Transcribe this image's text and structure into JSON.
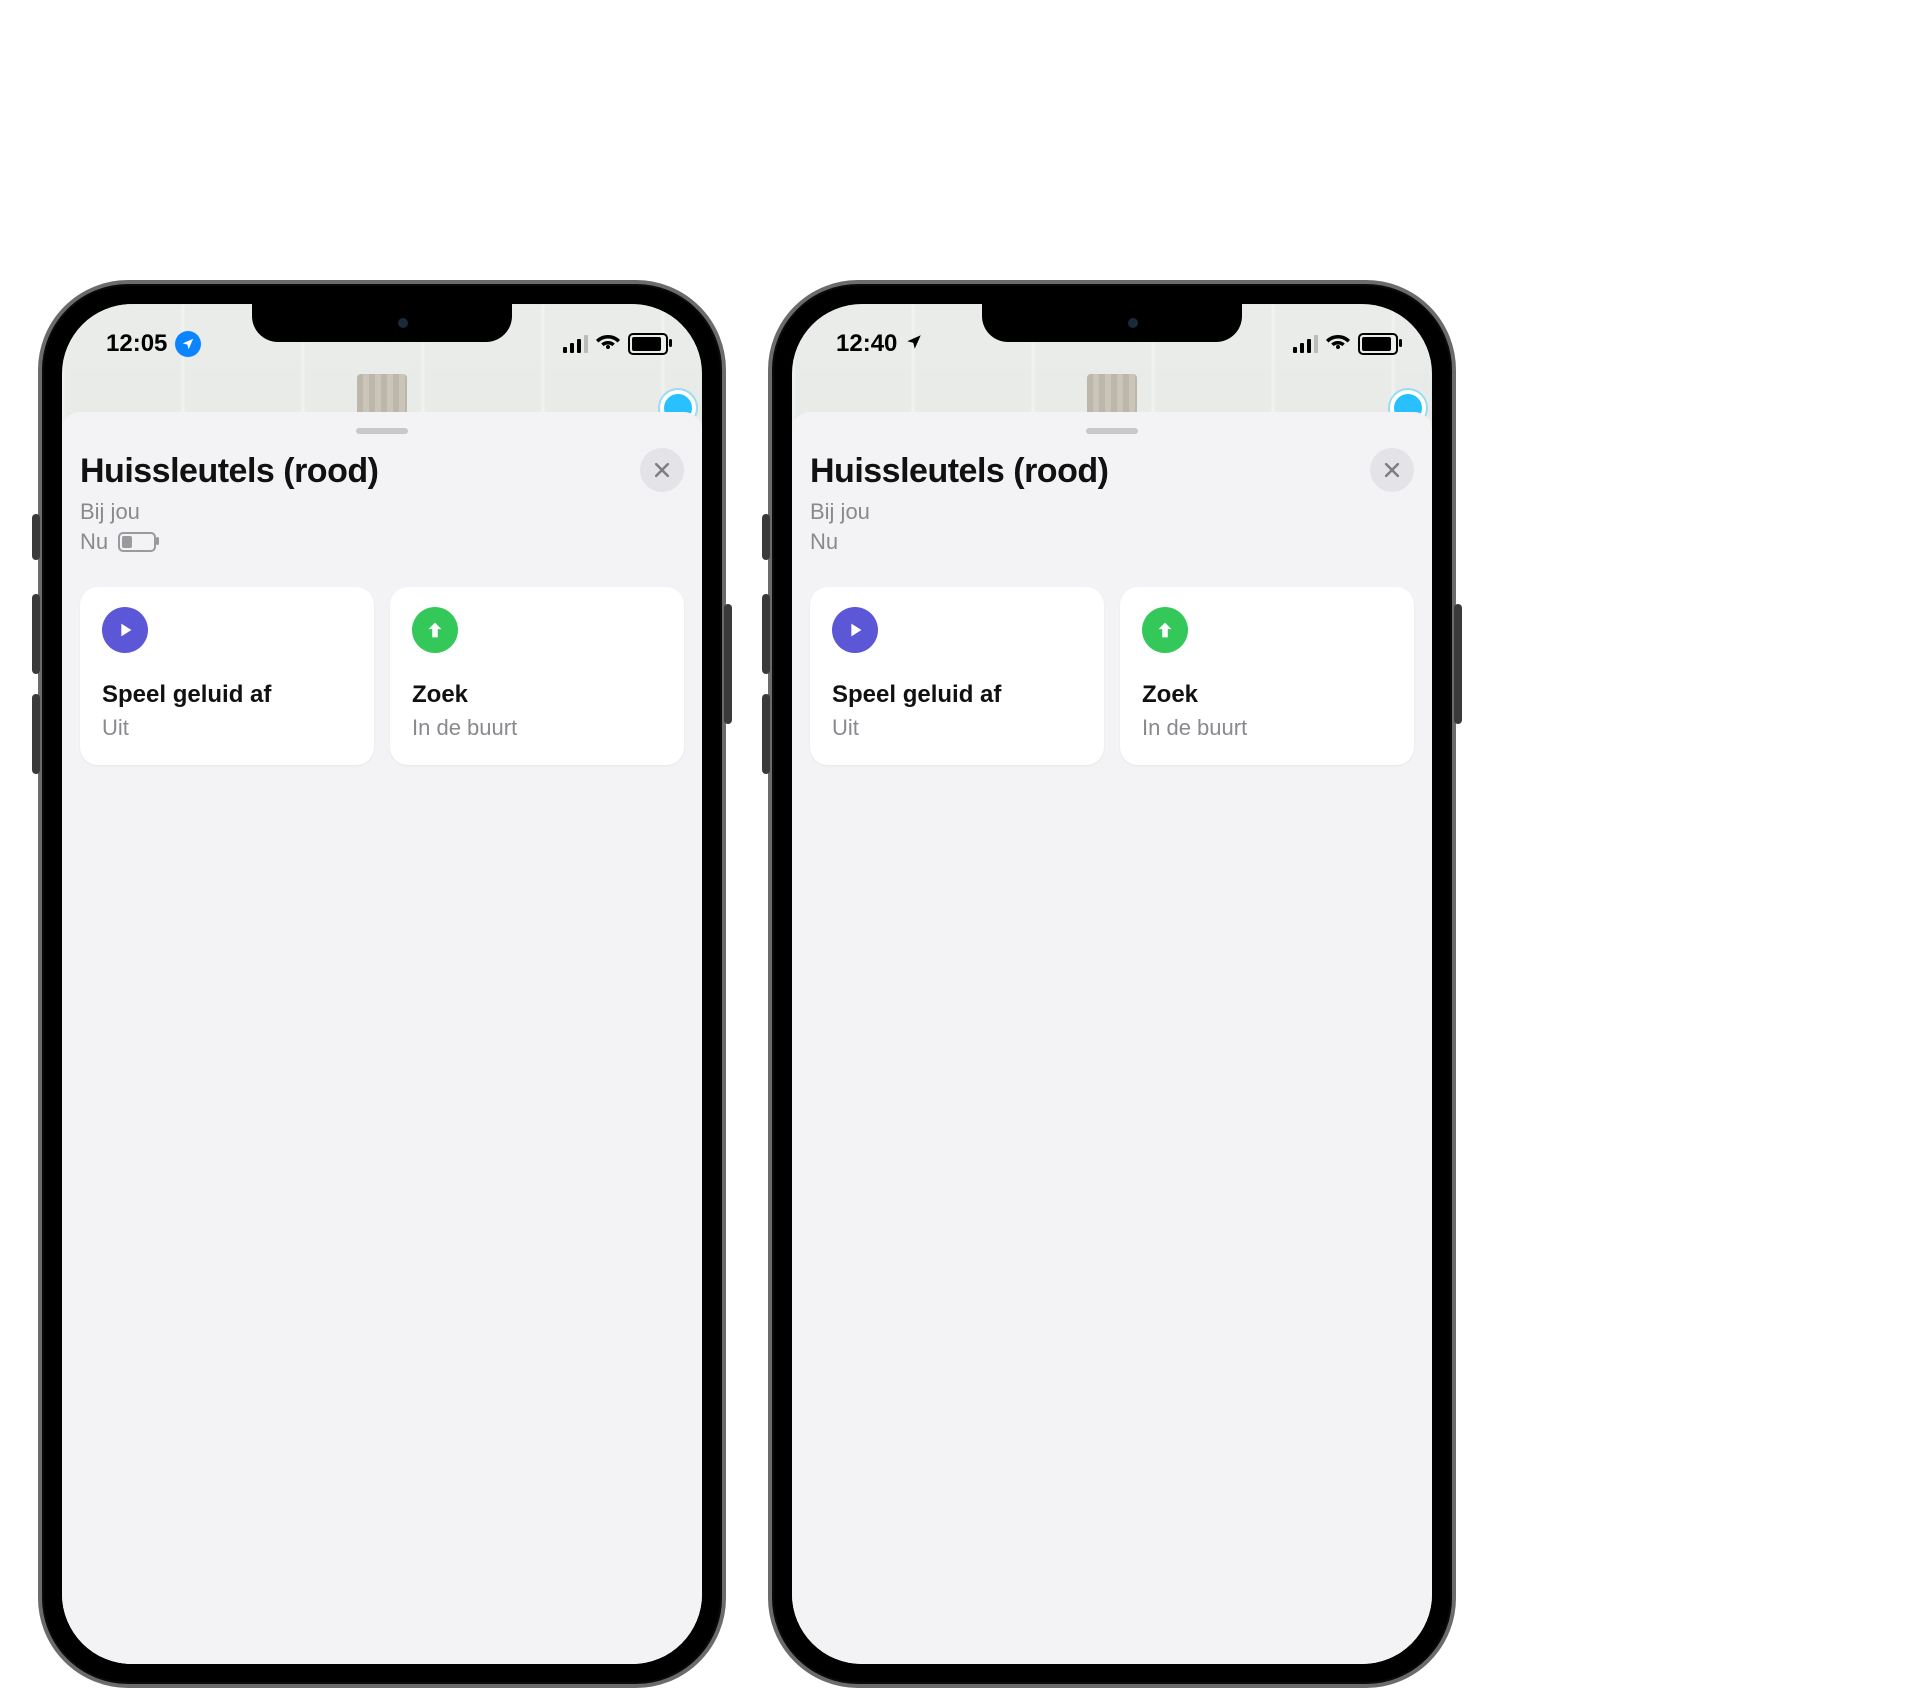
{
  "phones": [
    {
      "status": {
        "time": "12:05",
        "location_style": "badge"
      },
      "sheet": {
        "title": "Huissleutels (rood)",
        "subtitle": "Bij jou",
        "now_label": "Nu",
        "show_battery": true
      },
      "cards": {
        "play": {
          "title": "Speel geluid af",
          "subtitle": "Uit"
        },
        "find": {
          "title": "Zoek",
          "subtitle": "In de buurt"
        }
      }
    },
    {
      "status": {
        "time": "12:40",
        "location_style": "plain"
      },
      "sheet": {
        "title": "Huissleutels (rood)",
        "subtitle": "Bij jou",
        "now_label": "Nu",
        "show_battery": false
      },
      "cards": {
        "play": {
          "title": "Speel geluid af",
          "subtitle": "Uit"
        },
        "find": {
          "title": "Zoek",
          "subtitle": "In de buurt"
        }
      }
    }
  ]
}
